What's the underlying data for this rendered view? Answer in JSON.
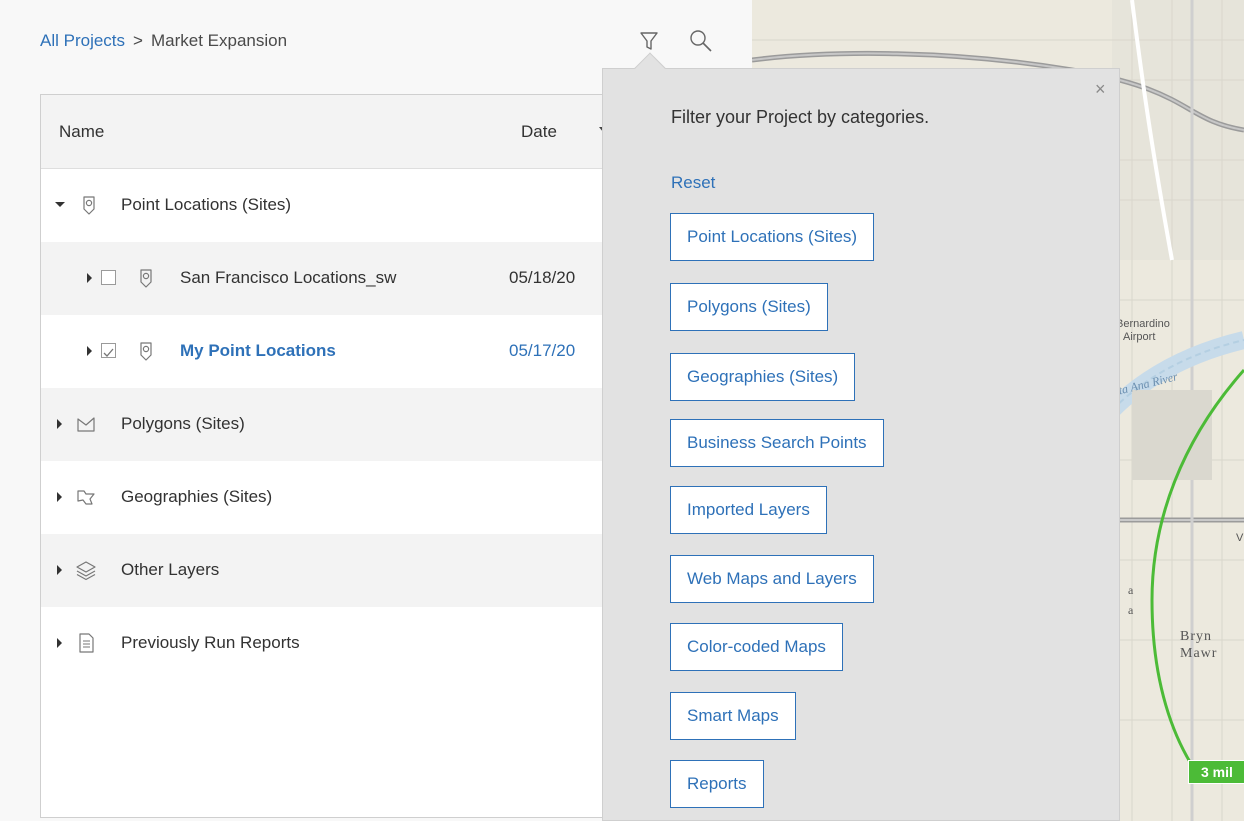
{
  "breadcrumb": {
    "root": "All Projects",
    "separator": ">",
    "current": "Market Expansion"
  },
  "toolbar": {
    "filter_icon": "funnel-icon",
    "search_icon": "search-icon"
  },
  "table": {
    "columns": {
      "name": "Name",
      "date": "Date"
    },
    "rows": [
      {
        "label": "Point Locations (Sites)",
        "icon": "map-pin-icon",
        "expanded": true,
        "date": ""
      },
      {
        "label": "San Francisco Locations_sw",
        "icon": "map-pin-icon",
        "checked": false,
        "date": "05/18/20"
      },
      {
        "label": "My Point Locations",
        "icon": "map-pin-icon",
        "checked": true,
        "date": "05/17/20"
      },
      {
        "label": "Polygons (Sites)",
        "icon": "polygon-icon",
        "date": ""
      },
      {
        "label": "Geographies (Sites)",
        "icon": "geography-icon",
        "date": ""
      },
      {
        "label": "Other Layers",
        "icon": "layers-icon",
        "date": ""
      },
      {
        "label": "Previously Run Reports",
        "icon": "report-icon",
        "date": ""
      }
    ]
  },
  "filter": {
    "title": "Filter your Project by categories.",
    "reset": "Reset",
    "close": "×",
    "categories": [
      "Point Locations (Sites)",
      "Polygons (Sites)",
      "Geographies (Sites)",
      "Business Search Points",
      "Imported Layers",
      "Web Maps and Layers",
      "Color-coded Maps",
      "Smart Maps",
      "Reports"
    ]
  },
  "map": {
    "labels": {
      "airport_line1": "Bernardino",
      "airport_line2": "'l Airport",
      "river": "nta Ana River",
      "town_line1": "Bryn",
      "town_line2": "Mawr",
      "frag_a1": "a",
      "frag_a2": "a",
      "frag_v": "V"
    },
    "ring_label": "3 mil",
    "ring_color": "#4cbb37"
  },
  "colors": {
    "accent": "#2e71b8",
    "background": "#1d5bbf"
  }
}
